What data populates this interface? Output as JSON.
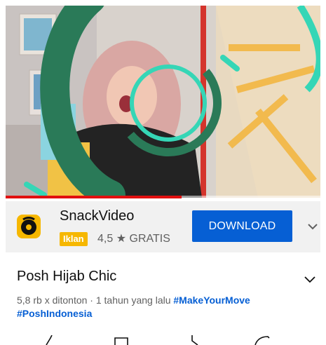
{
  "video": {
    "progress_fraction": 0.56
  },
  "ad": {
    "app_name": "SnackVideo",
    "badge": "Iklan",
    "rating": "4,5",
    "star_icon": "star-icon",
    "price": "GRATIS",
    "download_label": "DOWNLOAD",
    "expand_icon": "chevron-down-icon",
    "brand_color": "#f6b700",
    "button_color": "#065fd4"
  },
  "video_info": {
    "title": "Posh Hijab Chic",
    "views": "5,8 rb x ditonton",
    "separator": "·",
    "age": "1 tahun yang lalu",
    "hashtag1": "#MakeYourMove",
    "hashtag2": "#PoshIndonesia",
    "hashtag_color": "#065fd4"
  },
  "actions": {
    "icons": [
      "like-icon",
      "save-icon",
      "dislike-icon",
      "share-icon"
    ]
  },
  "colors": {
    "progress": "#e10f0f",
    "ring_green": "#2a7a58",
    "ring_teal": "#35d6b6",
    "accent_yellow": "#f2b43a"
  }
}
